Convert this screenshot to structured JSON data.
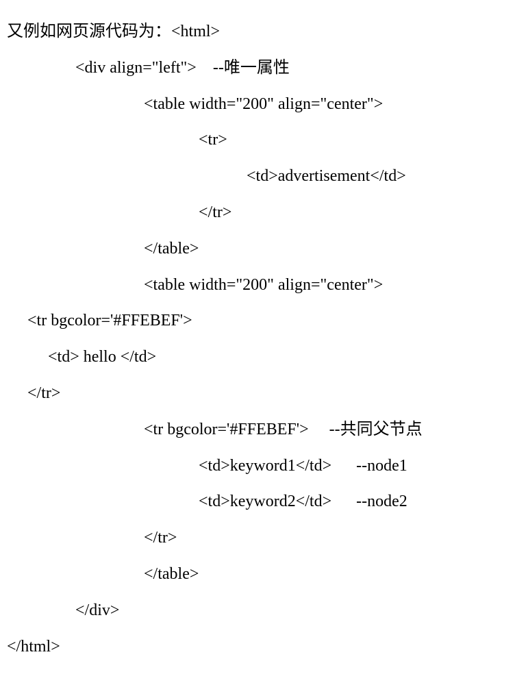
{
  "lines": {
    "l0": "又例如网页源代码为：<html>",
    "l1": "<div align=\"left\">    --唯一属性",
    "l2": "<table width=\"200\" align=\"center\">",
    "l3": "<tr>",
    "l4": "<td>advertisement</td>",
    "l5": "</tr>",
    "l6": "</table>",
    "l7": "<table width=\"200\" align=\"center\">",
    "l8": "<tr bgcolor='#FFEBEF'>",
    "l9": "<td> hello </td>",
    "l10": "</tr>",
    "l11": "<tr bgcolor='#FFEBEF'>     --共同父节点",
    "l12": "<td>keyword1</td>      --node1",
    "l13": "<td>keyword2</td>      --node2",
    "l14": "</tr>",
    "l15": "</table>",
    "l16": "</div>",
    "l17": "</html>"
  }
}
